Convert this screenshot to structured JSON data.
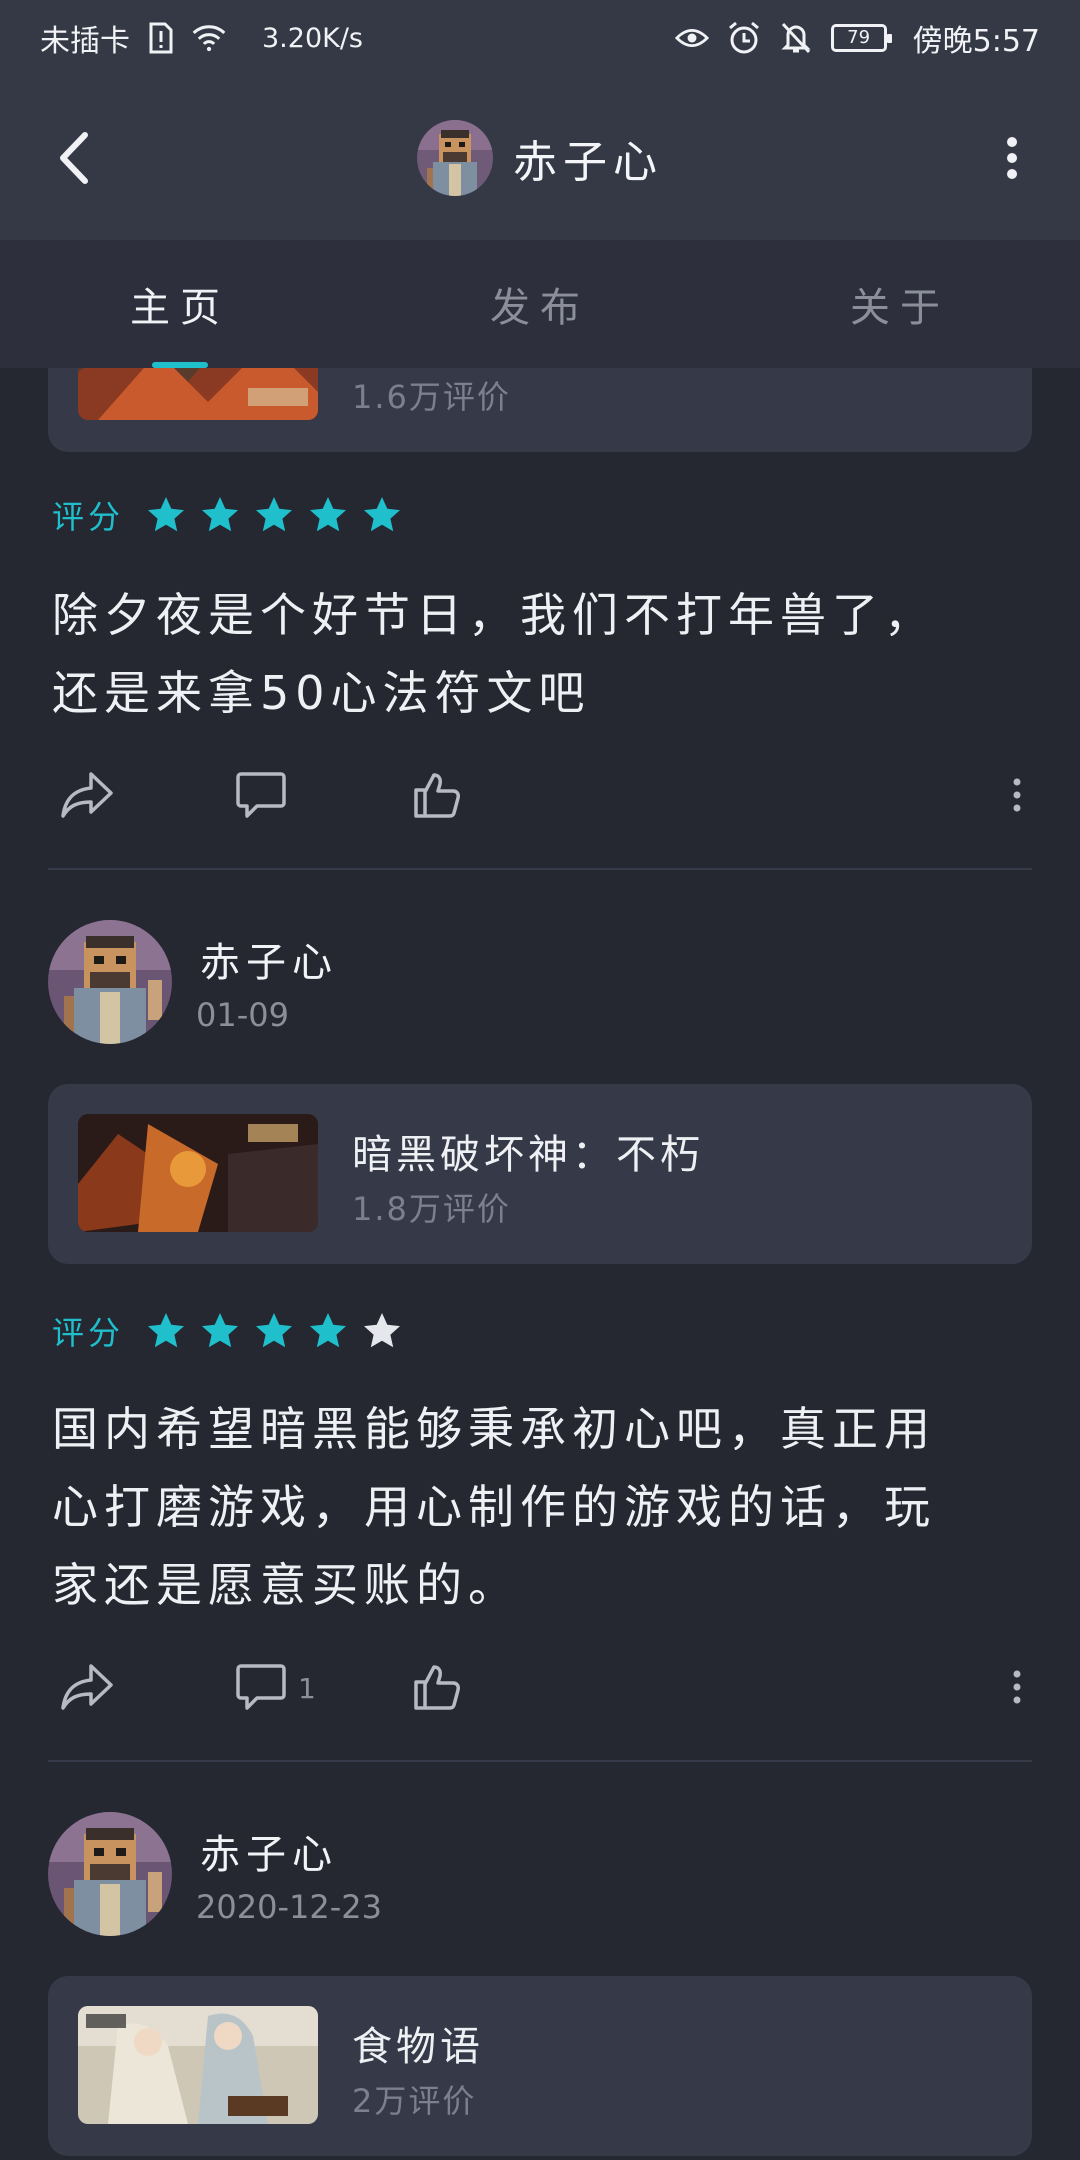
{
  "status_bar": {
    "carrier": "未插卡",
    "speed": "3.20K/s",
    "battery": "79",
    "time": "傍晚5:57"
  },
  "header": {
    "title": "赤子心"
  },
  "tabs": [
    {
      "label": "主页",
      "active": true
    },
    {
      "label": "发布",
      "active": false
    },
    {
      "label": "关于",
      "active": false
    }
  ],
  "accent_color": "#1fbfcc",
  "posts": [
    {
      "game": {
        "name": "",
        "reviews": "1.6万评价"
      },
      "rating_label": "评分",
      "stars": 5,
      "text_lines": [
        "除夕夜是个好节日，我们不打年兽了，",
        "还是来拿50心法符文吧"
      ],
      "comment_count": ""
    },
    {
      "author": "赤子心",
      "date": "01-09",
      "game": {
        "name": "暗黑破坏神：不朽",
        "reviews": "1.8万评价"
      },
      "rating_label": "评分",
      "stars": 4,
      "text_lines": [
        "国内希望暗黑能够秉承初心吧，真正用",
        "心打磨游戏，用心制作的游戏的话，玩",
        "家还是愿意买账的。"
      ],
      "comment_count": "1"
    },
    {
      "author": "赤子心",
      "date": "2020-12-23",
      "game": {
        "name": "食物语",
        "reviews": "2万评价"
      }
    }
  ]
}
